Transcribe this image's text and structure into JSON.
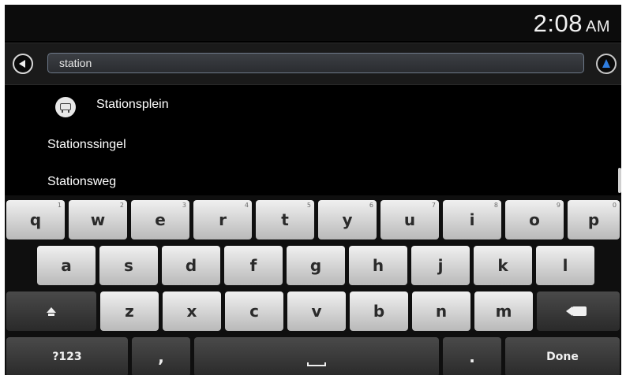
{
  "status_bar": {
    "time": "2:08",
    "ampm": "AM"
  },
  "search": {
    "query": "station"
  },
  "results": [
    {
      "label": "Stationsplein",
      "icon": "station-icon"
    },
    {
      "label": "Stationssingel"
    },
    {
      "label": "Stationsweg"
    }
  ],
  "keyboard": {
    "row1": [
      {
        "char": "q",
        "hint": "1"
      },
      {
        "char": "w",
        "hint": "2"
      },
      {
        "char": "e",
        "hint": "3"
      },
      {
        "char": "r",
        "hint": "4"
      },
      {
        "char": "t",
        "hint": "5"
      },
      {
        "char": "y",
        "hint": "6"
      },
      {
        "char": "u",
        "hint": "7"
      },
      {
        "char": "i",
        "hint": "8"
      },
      {
        "char": "o",
        "hint": "9"
      },
      {
        "char": "p",
        "hint": "0"
      }
    ],
    "row2": [
      "a",
      "s",
      "d",
      "f",
      "g",
      "h",
      "j",
      "k",
      "l"
    ],
    "row3": [
      "z",
      "x",
      "c",
      "v",
      "b",
      "n",
      "m"
    ],
    "symbols_label": "?123",
    "comma_label": ",",
    "period_label": ".",
    "done_label": "Done"
  },
  "colors": {
    "accent": "#2f7de0",
    "background": "#000000",
    "key_light": "#e6e6e6",
    "key_dark": "#3a3a3a"
  }
}
